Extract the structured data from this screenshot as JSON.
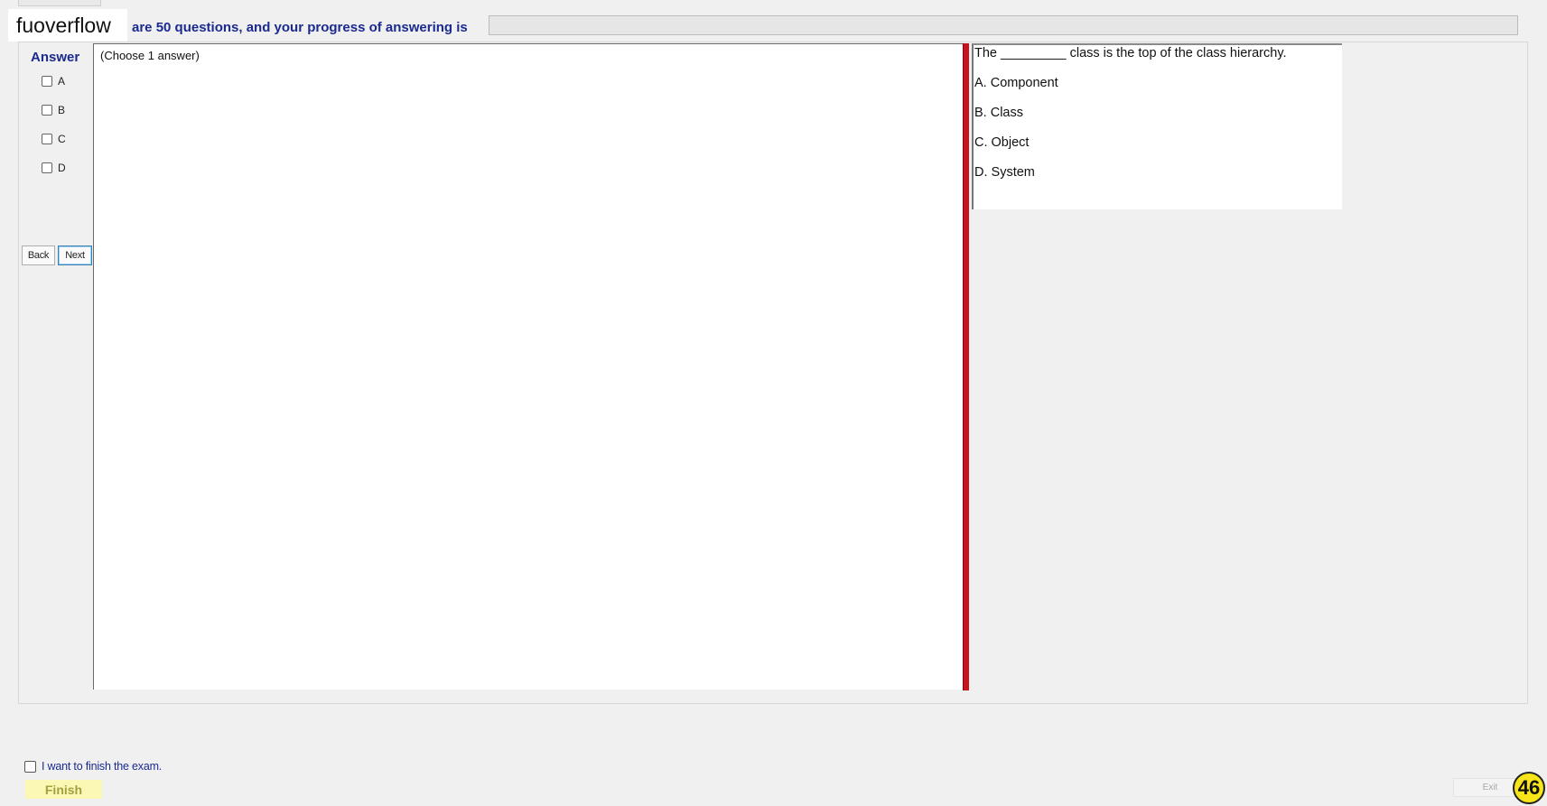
{
  "header": {
    "logo_text": "fuoverflow",
    "progress_text": "are 50 questions, and your progress of answering is"
  },
  "answer_panel": {
    "title": "Answer",
    "choices": [
      "A",
      "B",
      "C",
      "D"
    ],
    "back_label": "Back",
    "next_label": "Next"
  },
  "instructions": "(Choose 1 answer)",
  "question": {
    "text": "The _________ class is the top of the class hierarchy.",
    "options": [
      "A.  Component",
      "B.  Class",
      "C.  Object",
      "D.  System"
    ]
  },
  "footer": {
    "finish_confirm_label": "I want to finish the exam.",
    "finish_label": "Finish",
    "exit_label": "Exit",
    "page_badge": "46"
  },
  "colors": {
    "accent_blue": "#1b2a8f",
    "splitter_red": "#c7141d",
    "finish_yellow": "#fbf8b6",
    "badge_yellow": "#f7e51a"
  }
}
